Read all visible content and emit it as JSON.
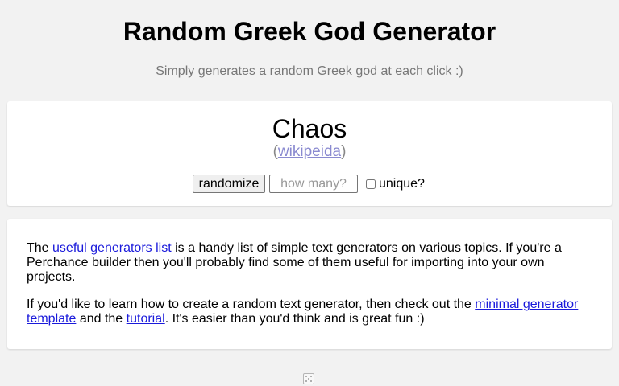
{
  "header": {
    "title": "Random Greek God Generator",
    "subtitle": "Simply generates a random Greek god at each click :)"
  },
  "generator": {
    "result": "Chaos",
    "wiki_open": "(",
    "wiki_link": "wikipeida",
    "wiki_close": ")",
    "randomize_label": "randomize",
    "how_many_placeholder": "how many?",
    "unique_label": "unique?",
    "unique_checked": false
  },
  "info": {
    "p1_pre": "The ",
    "p1_link": "useful generators list",
    "p1_post": " is a handy list of simple text generators on various topics. If you're a Perchance builder then you'll probably find some of them useful for importing into your own projects.",
    "p2_pre": "If you'd like to learn how to create a random text generator, then check out the ",
    "p2_link1": "minimal generator template",
    "p2_mid": " and the ",
    "p2_link2": "tutorial",
    "p2_post": ". It's easier than you'd think and is great fun :)"
  },
  "footer": {
    "icon": "dice-icon"
  },
  "colors": {
    "background": "#f2f2f2",
    "card": "#ffffff",
    "link": "#1a1adb",
    "wiki_link": "#8a8ad0",
    "subtitle": "#777777"
  }
}
